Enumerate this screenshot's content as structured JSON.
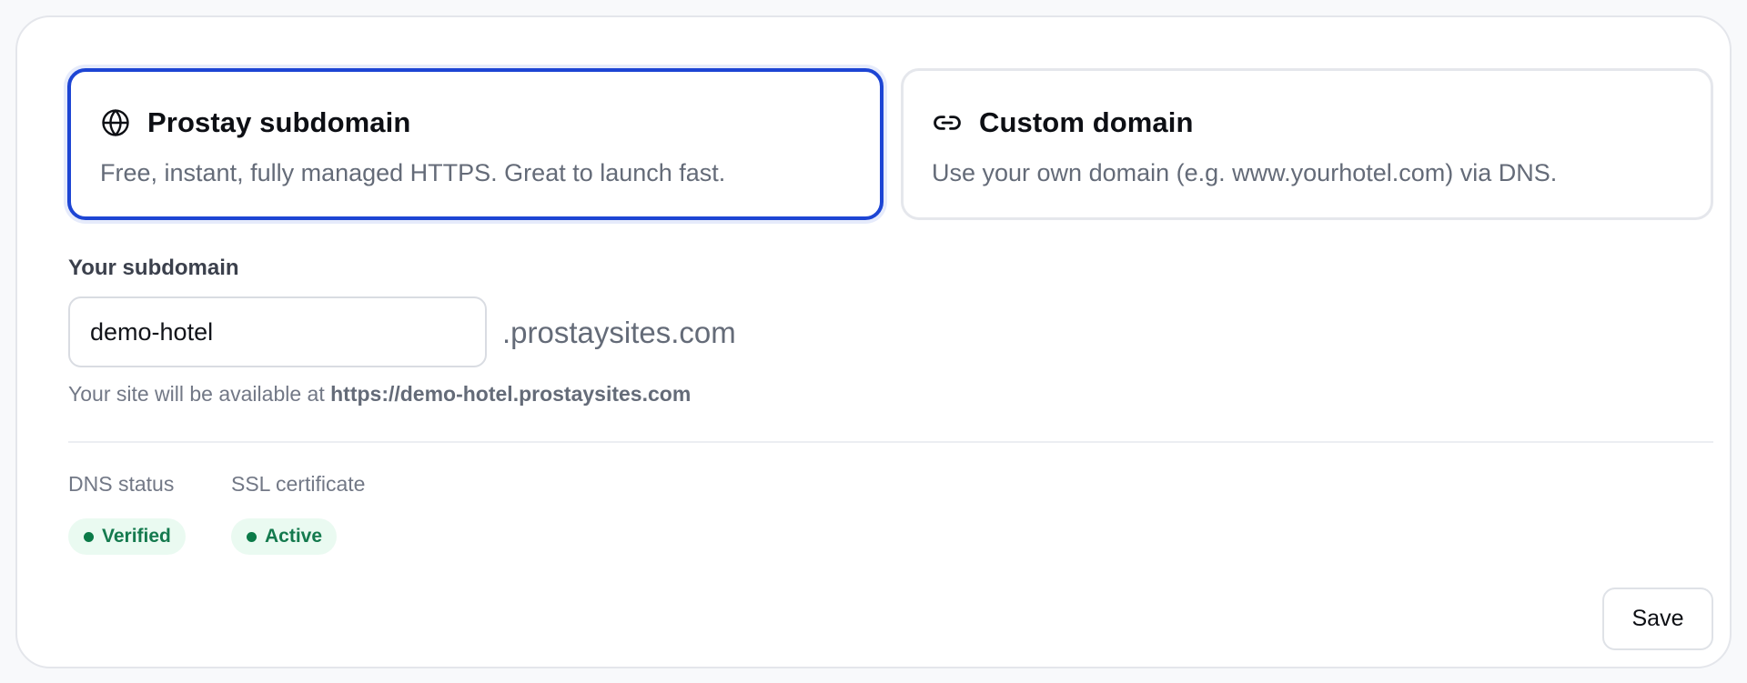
{
  "hosting_options": [
    {
      "title": "Prostay subdomain",
      "description": "Free, instant, fully managed HTTPS. Great to launch fast.",
      "icon": "globe-icon",
      "selected": true
    },
    {
      "title": "Custom domain",
      "description": "Use your own domain (e.g. www.yourhotel.com) via DNS.",
      "icon": "link-icon",
      "selected": false
    }
  ],
  "subdomain": {
    "label": "Your subdomain",
    "value": "demo-hotel",
    "suffix": ".prostaysites.com",
    "hint_prefix": "Your site will be available at",
    "hint_url": "https://demo-hotel.prostaysites.com"
  },
  "status": {
    "dns": {
      "label": "DNS status",
      "badge": "Verified"
    },
    "ssl": {
      "label": "SSL certificate",
      "badge": "Active"
    }
  },
  "actions": {
    "save_label": "Save"
  },
  "colors": {
    "accent": "#1d45d4",
    "success_text": "#147a4e",
    "success_bg": "#eafaf1",
    "success_dot": "#0b7a48"
  }
}
